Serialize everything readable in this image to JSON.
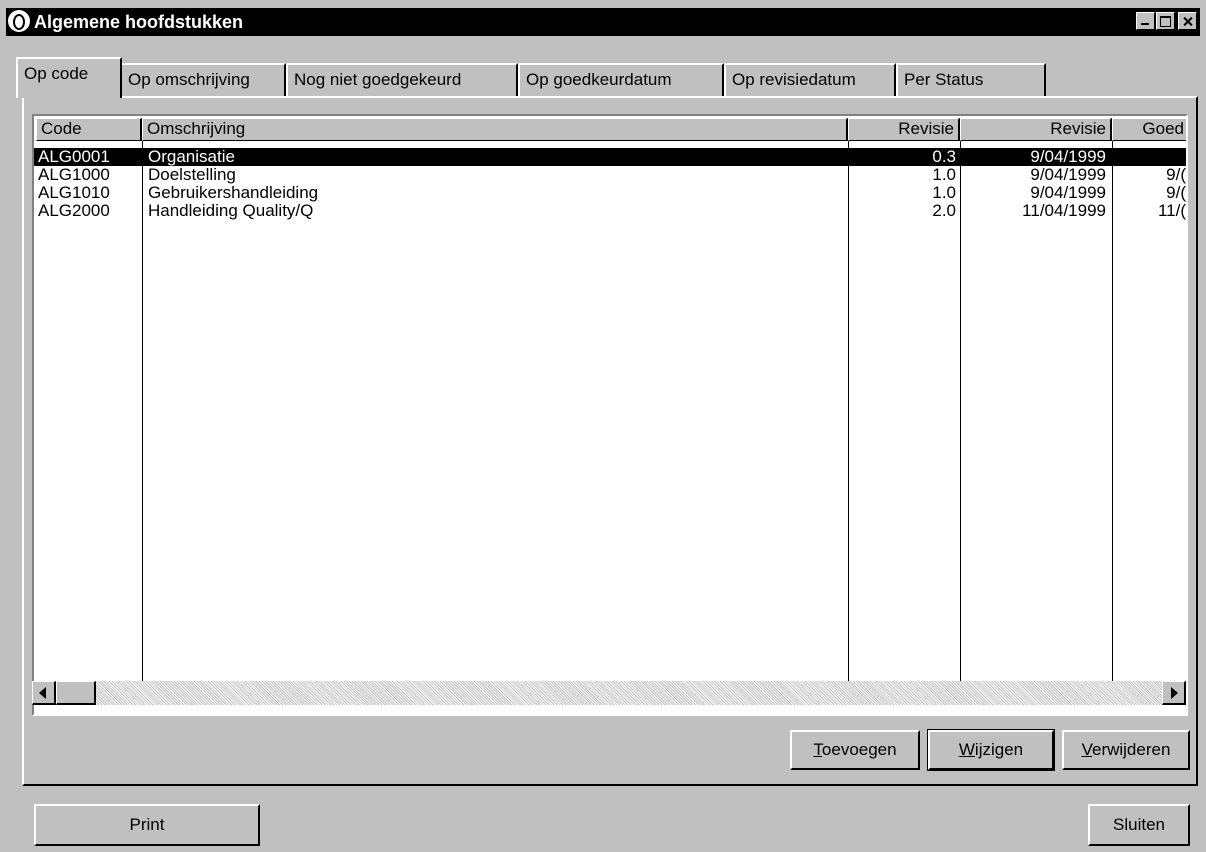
{
  "window": {
    "title": "Algemene hoofdstukken"
  },
  "tabs": [
    {
      "label": "Op code",
      "active": true
    },
    {
      "label": "Op omschrijving",
      "active": false
    },
    {
      "label": "Nog niet goedgekeurd",
      "active": false
    },
    {
      "label": "Op goedkeurdatum",
      "active": false
    },
    {
      "label": "Op revisiedatum",
      "active": false
    },
    {
      "label": "Per Status",
      "active": false
    }
  ],
  "list": {
    "columns": [
      "Code",
      "Omschrijving",
      "Revisie",
      "Revisie",
      "Goed"
    ],
    "rows": [
      {
        "code": "ALG0001",
        "omschrijving": "Organisatie",
        "revisie": "0.3",
        "revisiedatum": "9/04/1999",
        "goed": "",
        "selected": true
      },
      {
        "code": "ALG1000",
        "omschrijving": "Doelstelling",
        "revisie": "1.0",
        "revisiedatum": "9/04/1999",
        "goed": "9/(",
        "selected": false
      },
      {
        "code": "ALG1010",
        "omschrijving": "Gebruikershandleiding",
        "revisie": "1.0",
        "revisiedatum": "9/04/1999",
        "goed": "9/(",
        "selected": false
      },
      {
        "code": "ALG2000",
        "omschrijving": "Handleiding Quality/Q",
        "revisie": "2.0",
        "revisiedatum": "11/04/1999",
        "goed": "11/(",
        "selected": false
      }
    ]
  },
  "buttons": {
    "toevoegen": "Toevoegen",
    "wijzigen": "Wijzigen",
    "verwijderen": "Verwijderen",
    "print": "Print",
    "sluiten": "Sluiten"
  }
}
